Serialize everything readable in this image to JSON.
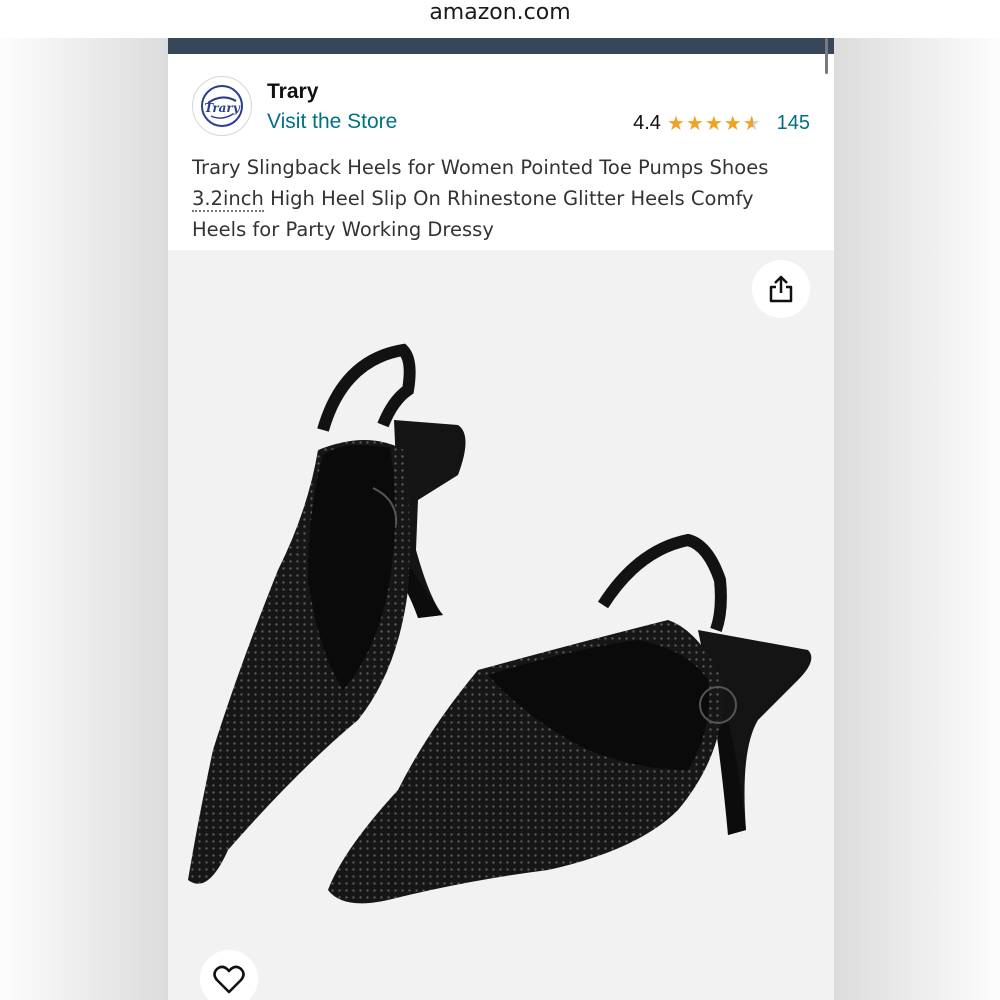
{
  "browser": {
    "url": "amazon.com"
  },
  "store": {
    "brand_name": "Trary",
    "visit_store_label": "Visit the Store",
    "logo_text": "Trary"
  },
  "rating": {
    "value": "4.4",
    "stars": 4.4,
    "count": "145"
  },
  "product": {
    "title_part1": "Trary Slingback Heels for Women Pointed Toe Pumps Shoes ",
    "title_underlined": "3.2inch",
    "title_part2": " High Heel Slip On Rhinestone Glitter Heels Comfy Heels for Party Working Dressy"
  },
  "gallery": {
    "image_description_icon": "product-photo",
    "share_icon": "share-icon",
    "favorite_icon": "heart-icon"
  },
  "colors": {
    "nav": "#37475a",
    "link": "#007185",
    "star": "#f0a223"
  }
}
